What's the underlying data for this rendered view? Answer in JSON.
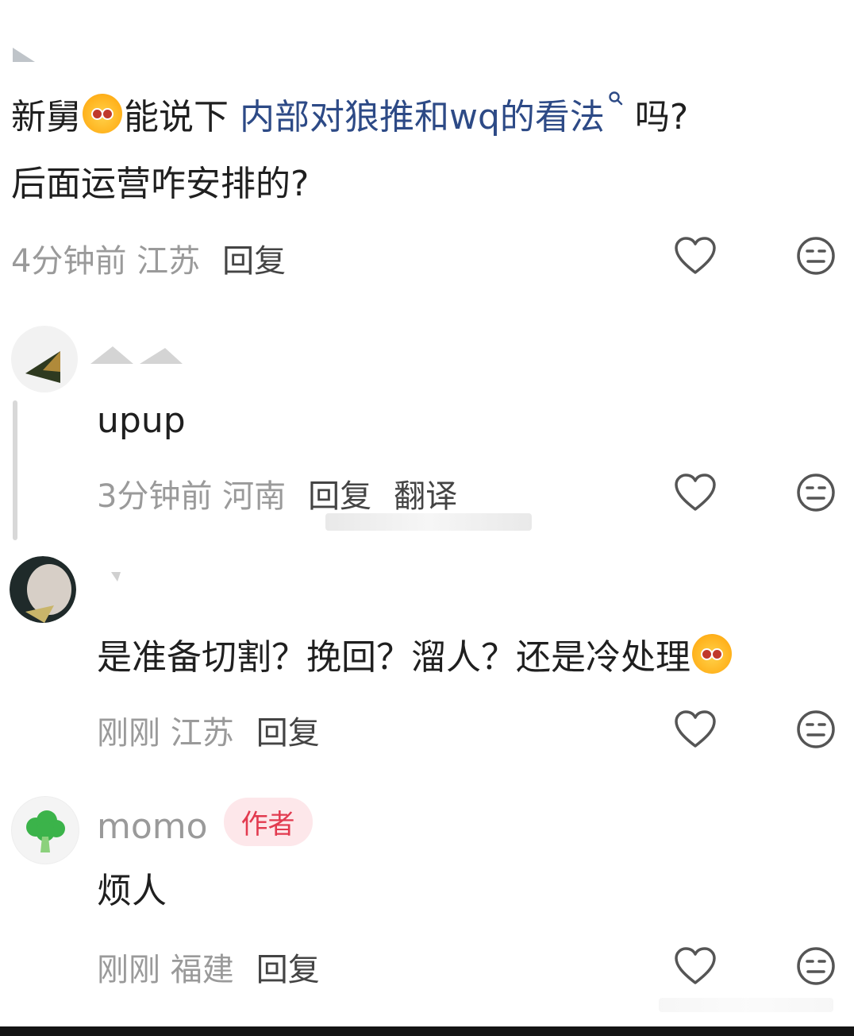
{
  "comment1": {
    "line1_before": "新舅",
    "line1_mid": "能说下 ",
    "line1_link": "内部对狼推和wq的看法",
    "line1_after": " 吗?",
    "line2": "后面运营咋安排的?",
    "time": "4分钟前",
    "location": "江苏",
    "reply": "回复"
  },
  "comment2": {
    "text": "upup",
    "time": "3分钟前",
    "location": "河南",
    "reply": "回复",
    "translate": "翻译"
  },
  "comment3": {
    "text": "是准备切割？挽回？溜人？还是冷处理",
    "time": "刚刚",
    "location": "江苏",
    "reply": "回复"
  },
  "comment4": {
    "username": "momo",
    "badge": "作者",
    "text": "烦人",
    "time": "刚刚",
    "location": "福建",
    "reply": "回复"
  },
  "icons": [
    "heart-icon",
    "neutral-face-icon",
    "search-icon"
  ],
  "colors": {
    "link": "#2d4a86",
    "badge_bg": "#fde7ea",
    "badge_text": "#e23a4f",
    "meta": "#9a9a9a"
  }
}
